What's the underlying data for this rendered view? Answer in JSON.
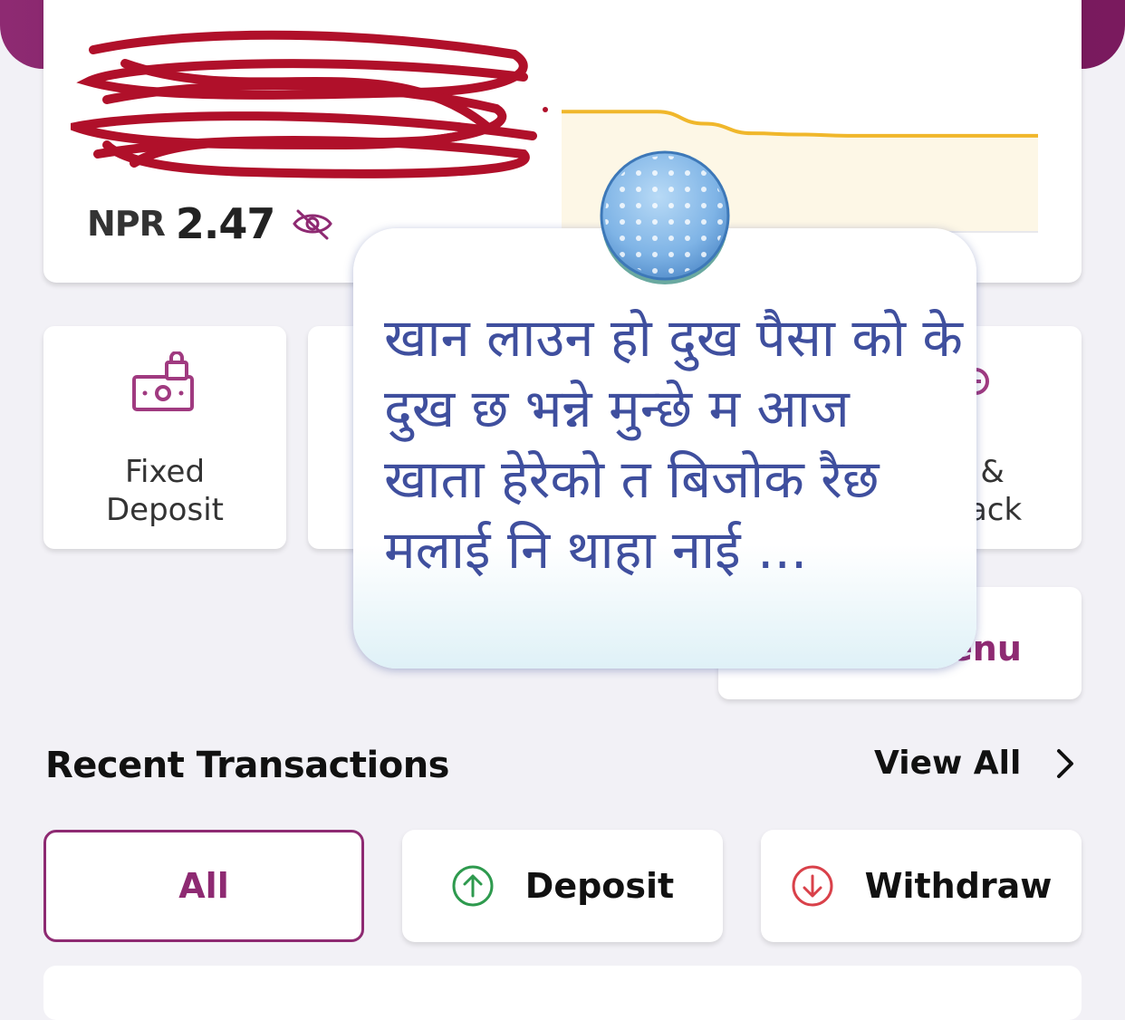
{
  "balance": {
    "currency": "NPR",
    "amount": "2.47"
  },
  "chart_data": {
    "type": "area",
    "x": [
      0,
      1,
      2,
      3,
      4,
      5,
      6,
      7,
      8,
      9,
      10
    ],
    "values": [
      100,
      100,
      100,
      90,
      82,
      81,
      80,
      80,
      80,
      80,
      80
    ],
    "ylim": [
      0,
      110
    ],
    "color": "#f0b72b"
  },
  "services": [
    {
      "label": "Fixed\nDeposit",
      "icon": "fixed-deposit-icon"
    },
    {
      "label": "p &\nPack",
      "icon": "top-up-icon"
    }
  ],
  "menu_label": "enu",
  "recent": {
    "title": "Recent Transactions",
    "view_all": "View All"
  },
  "filters": [
    {
      "label": "All",
      "active": true
    },
    {
      "label": "Deposit",
      "icon": "deposit-arrow-up-icon"
    },
    {
      "label": "Withdraw",
      "icon": "withdraw-arrow-down-icon"
    }
  ],
  "overlay": {
    "text": "खान लाउन हो दुख पैसा को के दुख छ भन्ने मुन्छे म आज खाता हेरेको त बिजोक रैछ मलाई नि थाहा नाई ..."
  },
  "colors": {
    "brand": "#8e2a72",
    "deposit": "#2e9a4e",
    "withdraw": "#d9414a",
    "chart_line": "#f0b72b",
    "overlay_text": "#3f4f9e"
  }
}
